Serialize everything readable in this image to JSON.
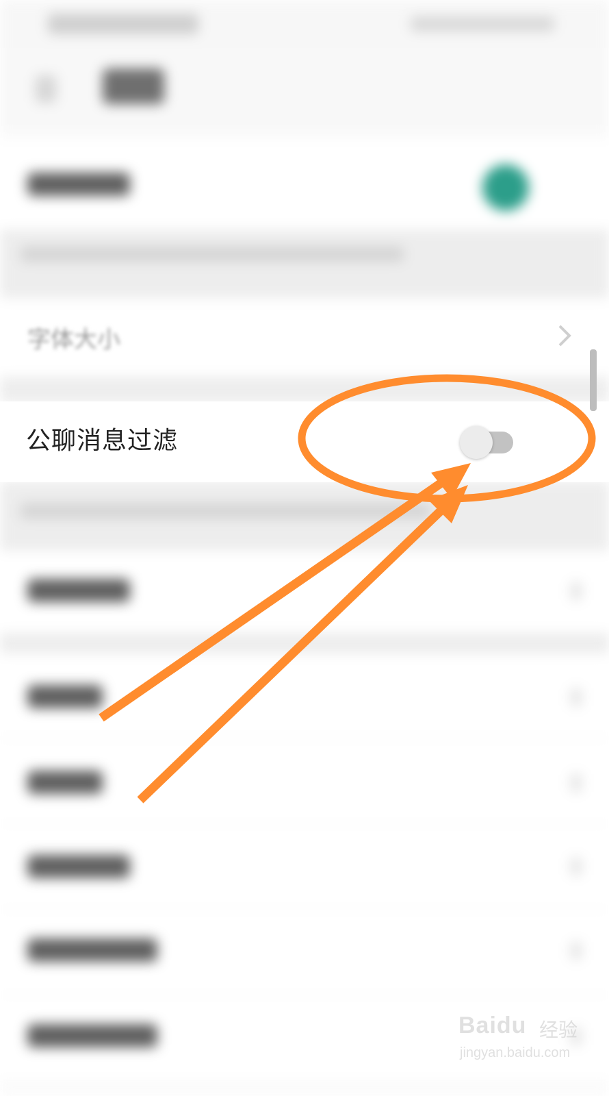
{
  "settings": {
    "partial_row_label": "字体大小",
    "filter_row": {
      "label": "公聊消息过滤",
      "toggle_on": false
    }
  },
  "annotation": {
    "color": "#ff8c2e"
  },
  "watermark": {
    "logo": "Baidu",
    "suffix": "经验",
    "url": "jingyan.baidu.com"
  },
  "colors": {
    "accent_green": "#2c9e8a",
    "toggle_track": "#c2c2c2",
    "toggle_thumb": "#ececec"
  }
}
